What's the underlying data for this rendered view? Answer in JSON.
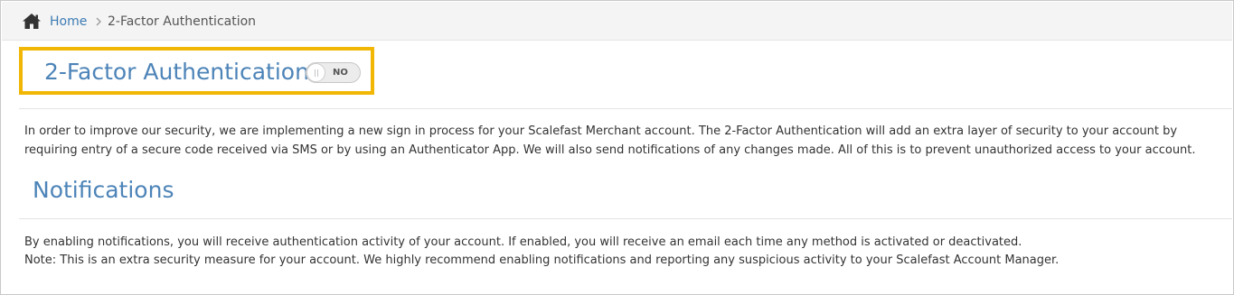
{
  "breadcrumb": {
    "home_icon": "home-icon",
    "home_label": "Home",
    "separator_icon": "chevron-right-icon",
    "current_label": "2-Factor Authentication"
  },
  "two_factor": {
    "title": "2-Factor Authentication",
    "toggle_label": "NO",
    "toggle_state": "off",
    "description": "In order to improve our security, we are implementing a new sign in process for your Scalefast Merchant account. The 2-Factor Authentication will add an extra layer of security to your account by requiring entry of a secure code received via SMS or by using an Authenticator App. We will also send notifications of any changes made. All of this is to prevent unauthorized access to your account."
  },
  "notifications": {
    "title": "Notifications",
    "description_line1": "By enabling notifications, you will receive authentication activity of your account. If enabled, you will receive an email each time any method is activated or deactivated.",
    "description_line2": "Note: This is an extra security measure for your account. We highly recommend enabling notifications and reporting any suspicious activity to your Scalefast Account Manager."
  },
  "colors": {
    "link": "#3d7bb3",
    "heading": "#4d84b8",
    "highlight_border": "#f2b705",
    "breadcrumb_bg": "#f4f4f4"
  }
}
